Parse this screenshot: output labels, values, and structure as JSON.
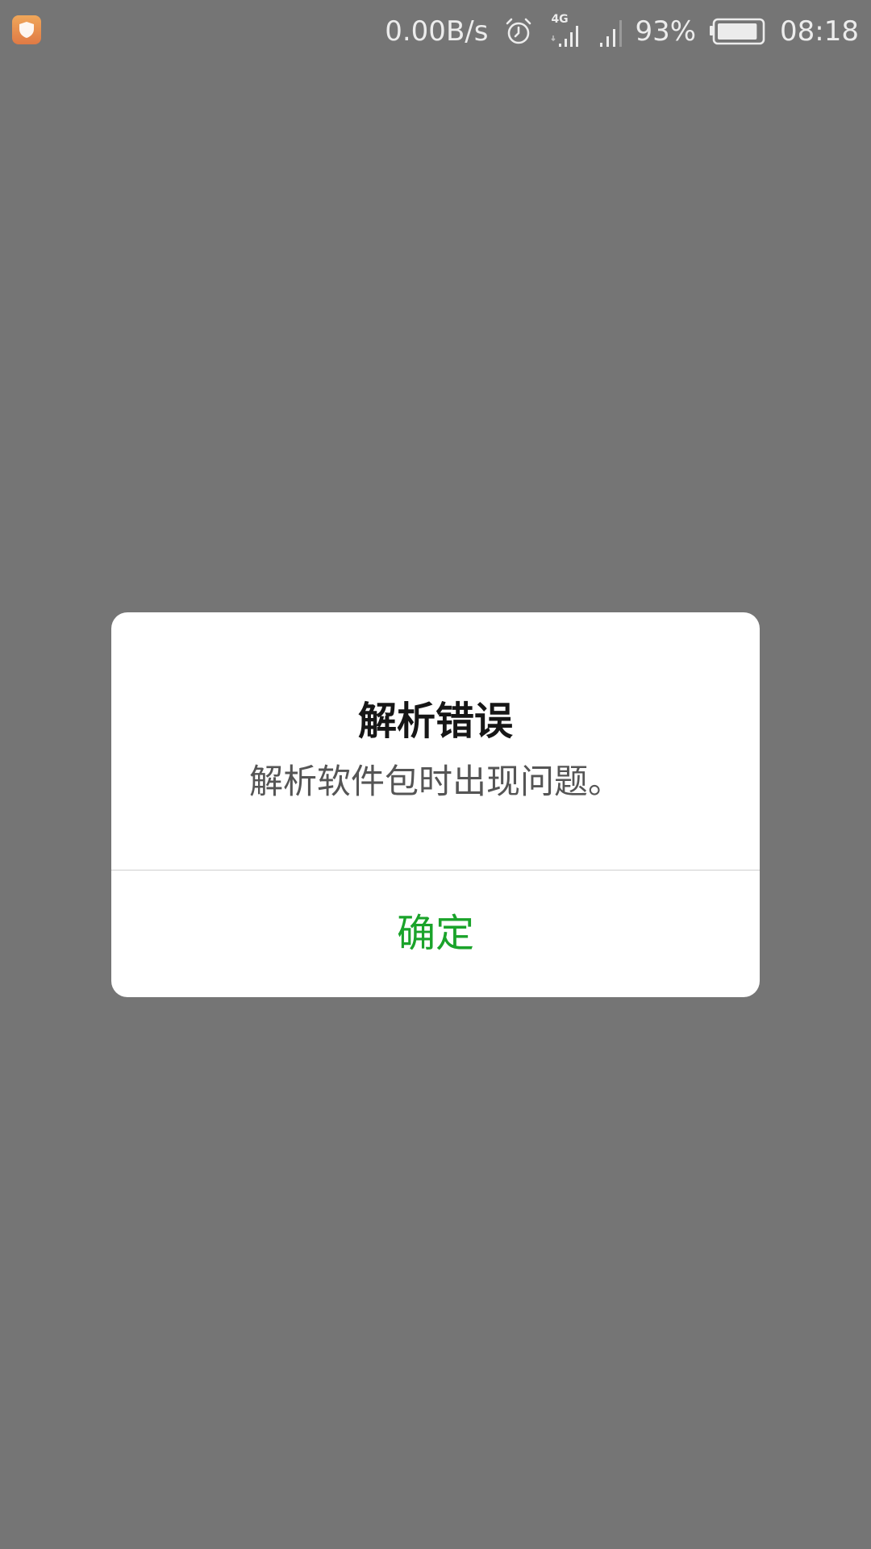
{
  "status_bar": {
    "app_icon": "shield-app-icon",
    "net_speed": "0.00B/s",
    "icons": [
      "alarm-icon",
      "cell-signal-4g-icon",
      "cell-signal-icon",
      "battery-icon"
    ],
    "network_type": "4G",
    "battery_percent": "93%",
    "battery_level": 0.93,
    "time": "08:18"
  },
  "dialog": {
    "title": "解析错误",
    "message": "解析软件包时出现问题。",
    "confirm_label": "确定"
  },
  "colors": {
    "background_scrim": "#757575",
    "dialog_background": "#ffffff",
    "title_text": "#161616",
    "message_text": "#555555",
    "accent_green": "#1aa32a",
    "app_icon_orange": "#e8894e"
  }
}
